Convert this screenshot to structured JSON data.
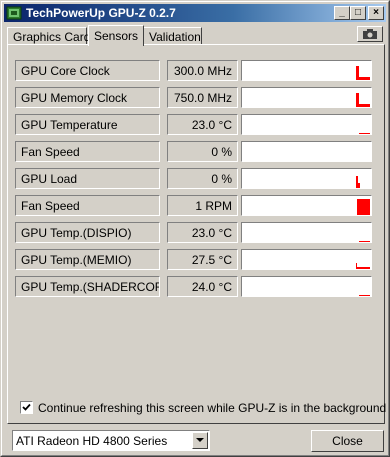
{
  "window": {
    "title": "TechPowerUp GPU-Z 0.2.7",
    "controls": {
      "minimize": "_",
      "maximize": "□",
      "close": "×"
    }
  },
  "tabs": [
    {
      "label": "Graphics Card",
      "active": false
    },
    {
      "label": "Sensors",
      "active": true
    },
    {
      "label": "Validation",
      "active": false
    }
  ],
  "toolbar": {
    "camera_icon": "camera-icon"
  },
  "sensors": [
    {
      "label": "GPU Core Clock",
      "value": "300.0 MHz",
      "graph": "spike"
    },
    {
      "label": "GPU Memory Clock",
      "value": "750.0 MHz",
      "graph": "spike"
    },
    {
      "label": "GPU Temperature",
      "value": "23.0 °C",
      "graph": "flat-low"
    },
    {
      "label": "Fan Speed",
      "value": "0 %",
      "graph": "empty"
    },
    {
      "label": "GPU Load",
      "value": "0 %",
      "graph": "small-spike"
    },
    {
      "label": "Fan Speed",
      "value": "1 RPM",
      "graph": "full"
    },
    {
      "label": "GPU Temp.(DISPIO)",
      "value": "23.0 °C",
      "graph": "flat-low"
    },
    {
      "label": "GPU Temp.(MEMIO)",
      "value": "27.5 °C",
      "graph": "step-low"
    },
    {
      "label": "GPU Temp.(SHADERCORE)",
      "value": "24.0 °C",
      "graph": "flat-low"
    }
  ],
  "refresh": {
    "checked": true,
    "label": "Continue refreshing this screen while GPU-Z is in the background"
  },
  "gpu_select": {
    "value": "ATI Radeon HD 4800 Series"
  },
  "close_label": "Close",
  "colors": {
    "graph_fill": "#ff0000",
    "title_start": "#0a246a",
    "title_end": "#a6caf0",
    "face": "#d4d0c8"
  }
}
